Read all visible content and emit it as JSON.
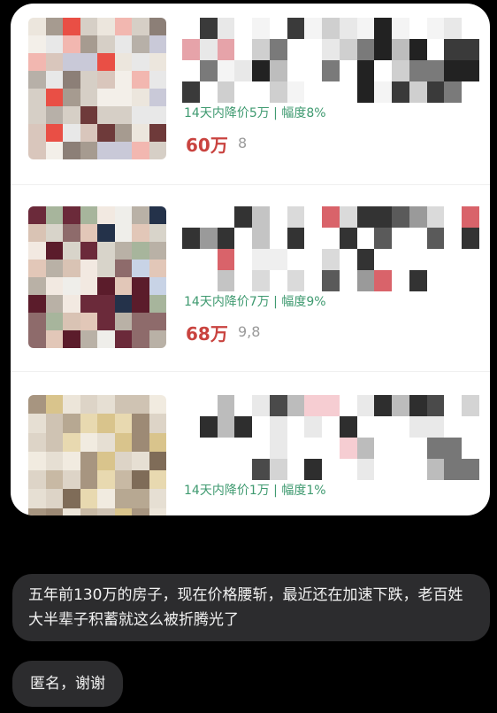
{
  "listings": [
    {
      "drop": "14天内降价5万 | 幅度8%",
      "price": "60万",
      "unit": "8"
    },
    {
      "drop": "14天内降价7万 | 幅度9%",
      "price": "68万",
      "unit": "9,8"
    },
    {
      "drop": "14天内降价1万 | 幅度1%",
      "price": "",
      "unit": ""
    }
  ],
  "messages": [
    {
      "text": "五年前130万的房子，现在价格腰斩，最近还在加速下跌，老百姓大半辈子积蓄就这么被折腾光了"
    },
    {
      "text": "匿名，谢谢"
    }
  ],
  "colors": {
    "drop": "#3f9a70",
    "price": "#c9433f",
    "bubble": "#2c2c2e"
  }
}
